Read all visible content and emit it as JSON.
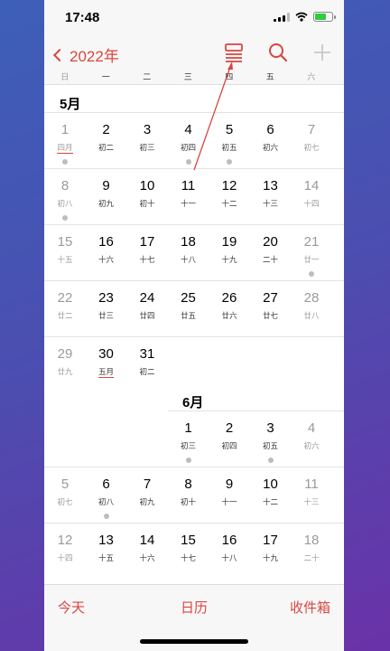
{
  "status_bar": {
    "time": "17:48",
    "battery_level": 0.65
  },
  "nav": {
    "back_label": "2022年"
  },
  "weekdays": [
    "日",
    "一",
    "二",
    "三",
    "四",
    "五",
    "六"
  ],
  "may": {
    "title": "5月",
    "days": [
      {
        "num": "1",
        "lunar": "四月",
        "weekend": true,
        "dot": true,
        "underline": true
      },
      {
        "num": "2",
        "lunar": "初二"
      },
      {
        "num": "3",
        "lunar": "初三"
      },
      {
        "num": "4",
        "lunar": "初四",
        "dot": true
      },
      {
        "num": "5",
        "lunar": "初五",
        "dot": true
      },
      {
        "num": "6",
        "lunar": "初六"
      },
      {
        "num": "7",
        "lunar": "初七",
        "weekend": true
      },
      {
        "num": "8",
        "lunar": "初八",
        "weekend": true,
        "dot": true
      },
      {
        "num": "9",
        "lunar": "初九"
      },
      {
        "num": "10",
        "lunar": "初十"
      },
      {
        "num": "11",
        "lunar": "十一"
      },
      {
        "num": "12",
        "lunar": "十二"
      },
      {
        "num": "13",
        "lunar": "十三"
      },
      {
        "num": "14",
        "lunar": "十四",
        "weekend": true
      },
      {
        "num": "15",
        "lunar": "十五",
        "weekend": true
      },
      {
        "num": "16",
        "lunar": "十六"
      },
      {
        "num": "17",
        "lunar": "十七"
      },
      {
        "num": "18",
        "lunar": "十八"
      },
      {
        "num": "19",
        "lunar": "十九"
      },
      {
        "num": "20",
        "lunar": "二十"
      },
      {
        "num": "21",
        "lunar": "廿一",
        "weekend": true,
        "dot": true
      },
      {
        "num": "22",
        "lunar": "廿二",
        "weekend": true
      },
      {
        "num": "23",
        "lunar": "廿三"
      },
      {
        "num": "24",
        "lunar": "廿四"
      },
      {
        "num": "25",
        "lunar": "廿五"
      },
      {
        "num": "26",
        "lunar": "廿六"
      },
      {
        "num": "27",
        "lunar": "廿七"
      },
      {
        "num": "28",
        "lunar": "廿八",
        "weekend": true
      },
      {
        "num": "29",
        "lunar": "廿九",
        "weekend": true
      },
      {
        "num": "30",
        "lunar": "五月",
        "underline": true
      },
      {
        "num": "31",
        "lunar": "初二"
      }
    ]
  },
  "june": {
    "title": "6月",
    "days": [
      {
        "num": "1",
        "lunar": "初三",
        "dot": true
      },
      {
        "num": "2",
        "lunar": "初四"
      },
      {
        "num": "3",
        "lunar": "初五",
        "dot": true
      },
      {
        "num": "4",
        "lunar": "初六",
        "weekend": true
      },
      {
        "num": "5",
        "lunar": "初七",
        "weekend": true
      },
      {
        "num": "6",
        "lunar": "初八",
        "dot": true
      },
      {
        "num": "7",
        "lunar": "初九"
      },
      {
        "num": "8",
        "lunar": "初十"
      },
      {
        "num": "9",
        "lunar": "十一"
      },
      {
        "num": "10",
        "lunar": "十二"
      },
      {
        "num": "11",
        "lunar": "十三",
        "weekend": true
      },
      {
        "num": "12",
        "lunar": "十四",
        "weekend": true
      },
      {
        "num": "13",
        "lunar": "十五"
      },
      {
        "num": "14",
        "lunar": "十六"
      },
      {
        "num": "15",
        "lunar": "十七"
      },
      {
        "num": "16",
        "lunar": "十八"
      },
      {
        "num": "17",
        "lunar": "十九"
      },
      {
        "num": "18",
        "lunar": "二十",
        "weekend": true
      }
    ]
  },
  "tab_bar": {
    "today": "今天",
    "calendars": "日历",
    "inbox": "收件箱"
  },
  "colors": {
    "accent": "#d9463f",
    "weekend": "#9a9a9a",
    "dot": "#bdbdbd"
  }
}
